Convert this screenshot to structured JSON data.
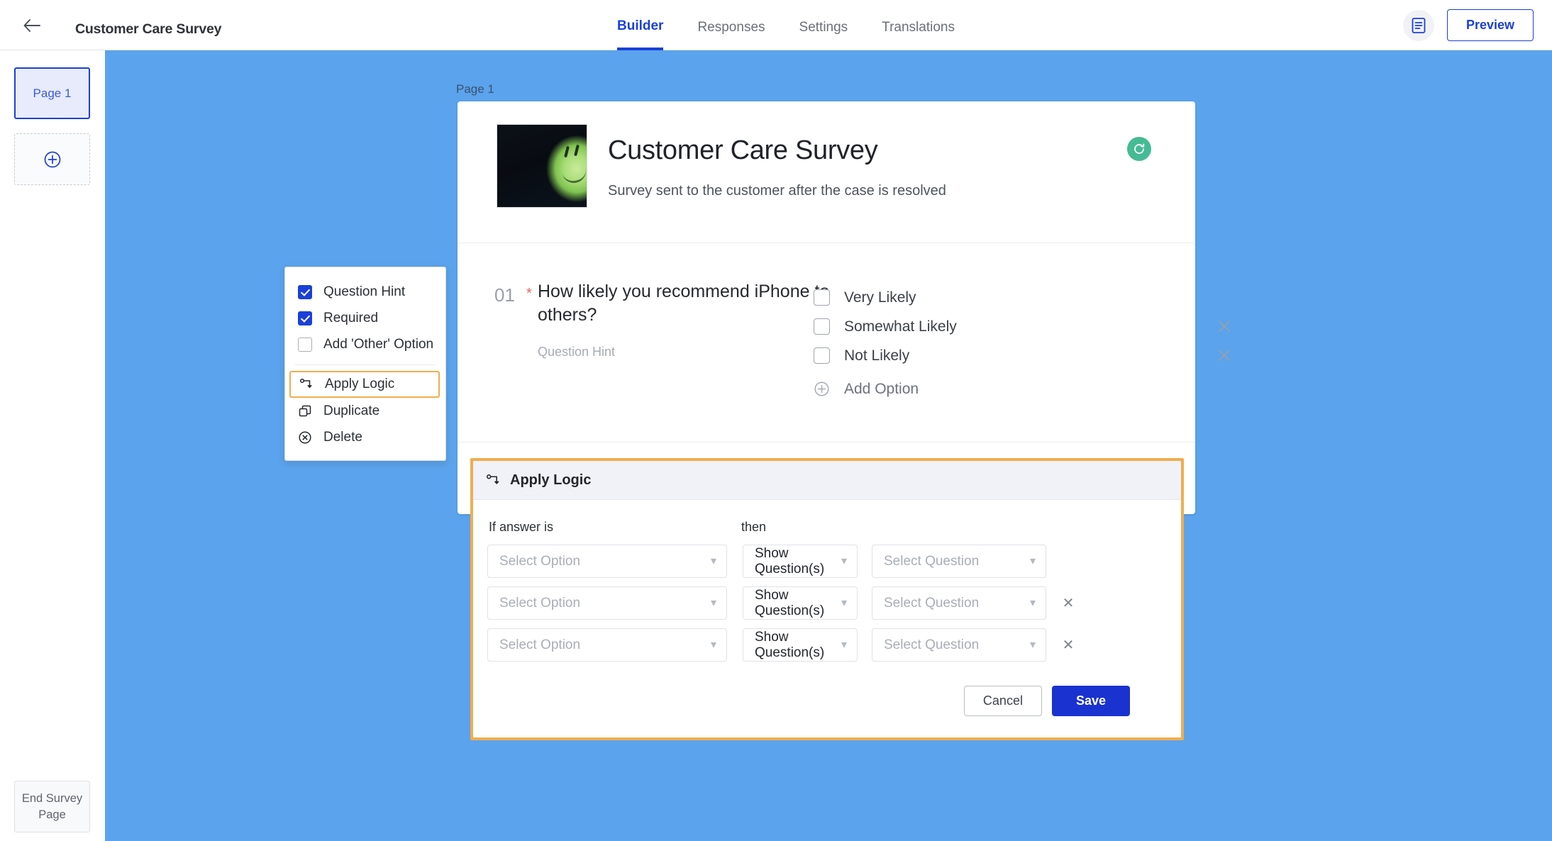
{
  "header": {
    "back_icon": "arrow-left-icon",
    "title": "Customer Care Survey",
    "tabs": [
      {
        "label": "Builder",
        "active": true
      },
      {
        "label": "Responses",
        "active": false
      },
      {
        "label": "Settings",
        "active": false
      },
      {
        "label": "Translations",
        "active": false
      }
    ],
    "doc_icon": "document-icon",
    "preview_label": "Preview"
  },
  "sidebar": {
    "page_thumb_label": "Page 1",
    "add_page_icon": "plus-circle-icon",
    "end_page_label": "End Survey Page"
  },
  "canvas": {
    "page_label": "Page 1",
    "background_color": "#5ba3ec"
  },
  "survey": {
    "title": "Customer Care Survey",
    "description": "Survey sent to the customer after the case is resolved",
    "badge_icon": "refresh-circle-icon",
    "badge_color": "#45bb94",
    "thumbnail_alt": "green-sphere-image"
  },
  "question": {
    "number": "01",
    "required_marker": "*",
    "text": "How likely you recommend iPhone to others?",
    "hint": "Question Hint",
    "options": [
      {
        "label": "Very Likely",
        "removable": false
      },
      {
        "label": "Somewhat Likely",
        "removable": true
      },
      {
        "label": "Not Likely",
        "removable": true
      }
    ],
    "add_option_label": "Add Option",
    "add_option_icon": "plus-circle-icon"
  },
  "add_question": {
    "icon": "plus-circle-icon"
  },
  "context_menu": {
    "items": [
      {
        "label": "Question Hint",
        "type": "checkbox",
        "checked": true
      },
      {
        "label": "Required",
        "type": "checkbox",
        "checked": true
      },
      {
        "label": "Add 'Other' Option",
        "type": "checkbox",
        "checked": false
      },
      {
        "label": "Apply Logic",
        "type": "action",
        "icon": "apply-logic-icon",
        "highlighted": true
      },
      {
        "label": "Duplicate",
        "type": "action",
        "icon": "duplicate-icon"
      },
      {
        "label": "Delete",
        "type": "action",
        "icon": "delete-circle-icon"
      }
    ],
    "highlight_color": "#f0ad4e"
  },
  "logic_panel": {
    "title": "Apply Logic",
    "title_icon": "apply-logic-icon",
    "border_color": "#f0ad4e",
    "col_if_label": "If answer is",
    "col_then_label": "then",
    "rows": [
      {
        "option": "Select Option",
        "action": "Show Question(s)",
        "question": "Select Question",
        "removable": false
      },
      {
        "option": "Select Option",
        "action": "Show Question(s)",
        "question": "Select Question",
        "removable": true
      },
      {
        "option": "Select Option",
        "action": "Show Question(s)",
        "question": "Select Question",
        "removable": true
      }
    ],
    "cancel_label": "Cancel",
    "save_label": "Save",
    "save_color": "#1a32cf"
  }
}
